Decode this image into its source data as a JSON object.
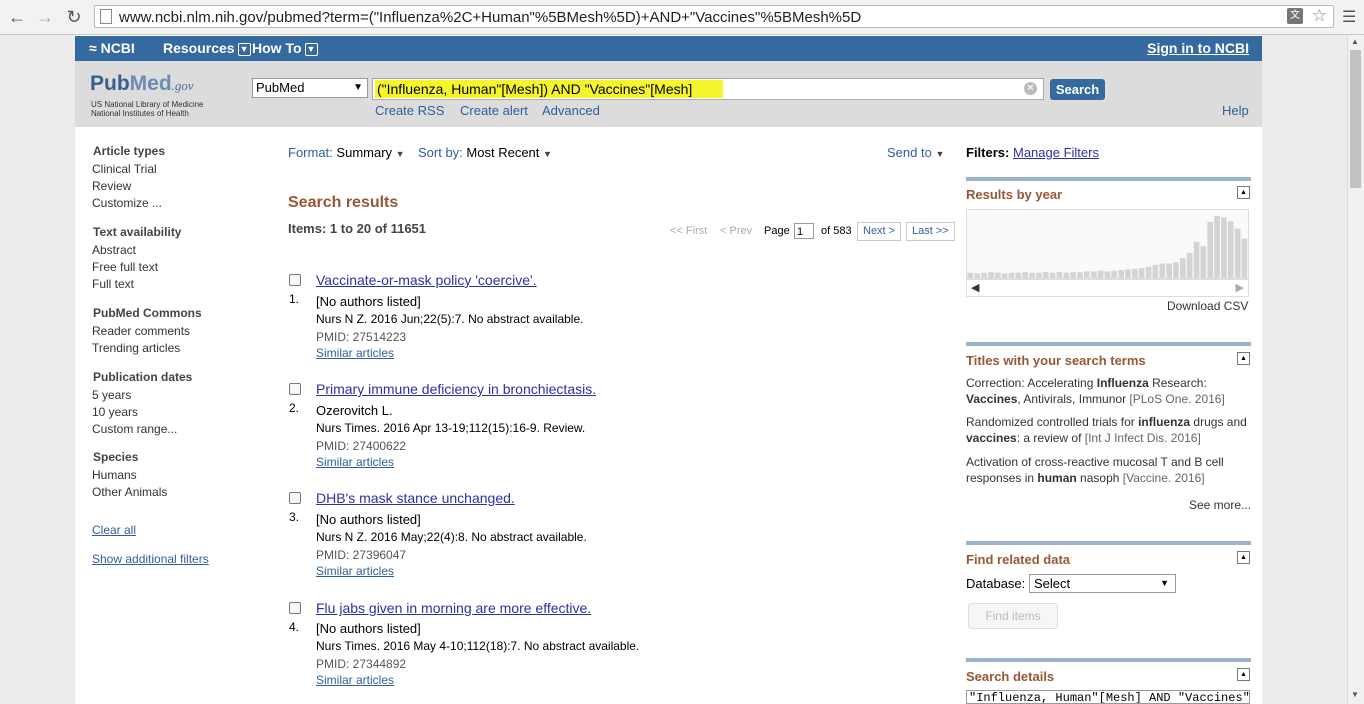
{
  "browser": {
    "url": "www.ncbi.nlm.nih.gov/pubmed?term=(\"Influenza%2C+Human\"%5BMesh%5D)+AND+\"Vaccines\"%5BMesh%5D"
  },
  "ncbi_bar": {
    "logo": "NCBI",
    "resources": "Resources",
    "howto": "How To",
    "signin": "Sign in to NCBI"
  },
  "header": {
    "logo_pub": "Pub",
    "logo_med": "Med",
    "logo_gov": ".gov",
    "nlm_line1": "US National Library of Medicine",
    "nlm_line2": "National Institutes of Health",
    "db_selected": "PubMed",
    "query": "(\"Influenza, Human\"[Mesh]) AND \"Vaccines\"[Mesh]",
    "search_button": "Search",
    "create_rss": "Create RSS",
    "create_alert": "Create alert",
    "advanced": "Advanced",
    "help": "Help"
  },
  "filters": {
    "article_types": {
      "heading": "Article types",
      "items": [
        "Clinical Trial",
        "Review",
        "Customize ..."
      ]
    },
    "text_availability": {
      "heading": "Text availability",
      "items": [
        "Abstract",
        "Free full text",
        "Full text"
      ]
    },
    "pubmed_commons": {
      "heading": "PubMed Commons",
      "items": [
        "Reader comments",
        "Trending articles"
      ]
    },
    "publication_dates": {
      "heading": "Publication dates",
      "items": [
        "5 years",
        "10 years",
        "Custom range..."
      ]
    },
    "species": {
      "heading": "Species",
      "items": [
        "Humans",
        "Other Animals"
      ]
    },
    "clear_all": "Clear all",
    "show_additional": "Show additional filters"
  },
  "toolbar": {
    "format_label": "Format:",
    "format_value": "Summary",
    "sort_label": "Sort by:",
    "sort_value": "Most Recent",
    "send_to": "Send to"
  },
  "results": {
    "title": "Search results",
    "items_label": "Items: 1 to 20 of 11651",
    "pager": {
      "first": "<< First",
      "prev": "< Prev",
      "page_label": "Page",
      "page": "1",
      "of": "of 583",
      "next": "Next >",
      "last": "Last >>"
    },
    "list": [
      {
        "num": "1.",
        "title": "Vaccinate-or-mask policy 'coercive'.",
        "authors": "[No authors listed]",
        "citation": "Nurs N Z. 2016 Jun;22(5):7. No abstract available.",
        "pmid": "PMID: 27514223",
        "similar": "Similar articles"
      },
      {
        "num": "2.",
        "title": "Primary immune deficiency in bronchiectasis.",
        "authors": "Ozerovitch L.",
        "citation": "Nurs Times. 2016 Apr 13-19;112(15):16-9. Review.",
        "pmid": "PMID: 27400622",
        "similar": "Similar articles"
      },
      {
        "num": "3.",
        "title": "DHB's mask stance unchanged.",
        "authors": "[No authors listed]",
        "citation": "Nurs N Z. 2016 May;22(4):8. No abstract available.",
        "pmid": "PMID: 27396047",
        "similar": "Similar articles"
      },
      {
        "num": "4.",
        "title": "Flu jabs given in morning are more effective.",
        "authors": "[No authors listed]",
        "citation": "Nurs Times. 2016 May 4-10;112(18):7. No abstract available.",
        "pmid": "PMID: 27344892",
        "similar": "Similar articles"
      }
    ]
  },
  "sidebar": {
    "filters_label": "Filters:",
    "manage_filters": "Manage Filters",
    "results_by_year": "Results by year",
    "year_bars": [
      0.08,
      0.07,
      0.08,
      0.09,
      0.08,
      0.07,
      0.08,
      0.08,
      0.09,
      0.08,
      0.08,
      0.09,
      0.08,
      0.09,
      0.08,
      0.09,
      0.09,
      0.1,
      0.1,
      0.11,
      0.1,
      0.11,
      0.12,
      0.13,
      0.14,
      0.15,
      0.17,
      0.2,
      0.22,
      0.22,
      0.24,
      0.3,
      0.38,
      0.55,
      0.48,
      0.85,
      0.94,
      0.92,
      0.86,
      0.75,
      0.6
    ],
    "download_csv": "Download CSV",
    "titles_heading": "Titles with your search terms",
    "titles": [
      {
        "pre": "Correction: Accelerating ",
        "b1": "Influenza",
        "mid": " Research: ",
        "b2": "Vaccines",
        "post": ", Antivirals, Immunor ",
        "journal": "[PLoS One. 2016]"
      },
      {
        "pre": "Randomized controlled trials for ",
        "b1": "influenza",
        "mid": " drugs and ",
        "b2": "vaccines",
        "post": ": a review of ",
        "journal": "[Int J Infect Dis. 2016]"
      },
      {
        "pre": "Activation of cross-reactive mucosal T and B cell responses in ",
        "b1": "human",
        "mid": " nasoph ",
        "b2": "",
        "post": "",
        "journal": "[Vaccine. 2016]"
      }
    ],
    "see_more": "See more...",
    "find_related": "Find related data",
    "database_label": "Database:",
    "database_value": "Select",
    "find_items": "Find items",
    "search_details": "Search details",
    "search_details_text": "\"Influenza, Human\"[Mesh] AND \"Vaccines\""
  }
}
